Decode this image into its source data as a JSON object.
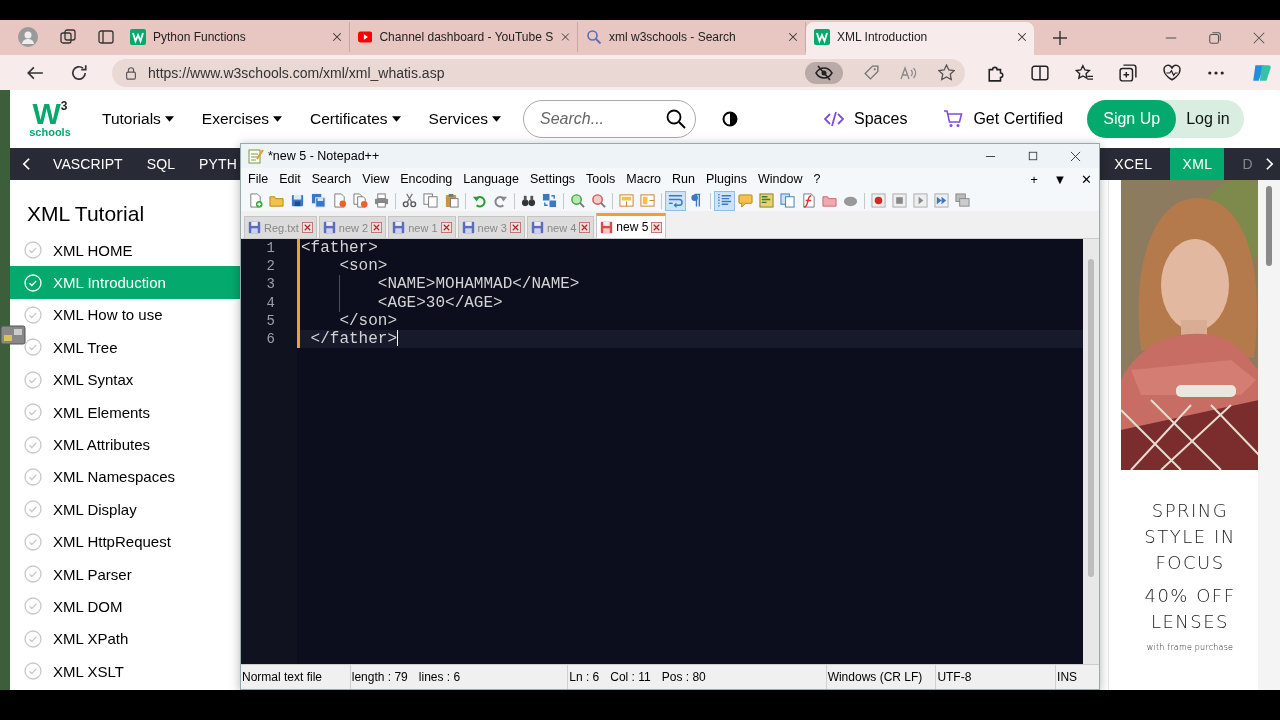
{
  "browser": {
    "tabs": [
      {
        "title": "Python Functions",
        "kind": "site",
        "selected": false
      },
      {
        "title": "Channel dashboard - YouTube S",
        "kind": "video",
        "selected": false
      },
      {
        "title": "xml w3schools - Search",
        "kind": "search",
        "selected": false
      },
      {
        "title": "XML Introduction",
        "kind": "site",
        "selected": true
      }
    ],
    "url": "https://www.w3schools.com/xml/xml_whatis.asp"
  },
  "site": {
    "logo": {
      "mark": "W",
      "sup": "3",
      "name": "schools"
    },
    "nav": [
      "Tutorials",
      "Exercises",
      "Certificates",
      "Services"
    ],
    "search": {
      "placeholder": "Search..."
    },
    "spaces": "Spaces",
    "certified": "Get Certified",
    "signup": "Sign Up",
    "login": "Log in",
    "topics_left": [
      {
        "label": "VASCRIPT",
        "selected": false
      },
      {
        "label": "SQL",
        "selected": false
      },
      {
        "label": "PYTH",
        "selected": false
      }
    ],
    "topics_right": [
      {
        "label": "XCEL",
        "selected": false
      },
      {
        "label": "XML",
        "selected": true
      },
      {
        "label": "D",
        "selected": false
      }
    ],
    "sidebar": {
      "title": "XML Tutorial",
      "items": [
        {
          "label": "XML HOME",
          "selected": false
        },
        {
          "label": "XML Introduction",
          "selected": true
        },
        {
          "label": "XML How to use",
          "selected": false
        },
        {
          "label": "XML Tree",
          "selected": false
        },
        {
          "label": "XML Syntax",
          "selected": false
        },
        {
          "label": "XML Elements",
          "selected": false
        },
        {
          "label": "XML Attributes",
          "selected": false
        },
        {
          "label": "XML Namespaces",
          "selected": false
        },
        {
          "label": "XML Display",
          "selected": false
        },
        {
          "label": "XML HttpRequest",
          "selected": false
        },
        {
          "label": "XML Parser",
          "selected": false
        },
        {
          "label": "XML DOM",
          "selected": false
        },
        {
          "label": "XML XPath",
          "selected": false
        },
        {
          "label": "XML XSLT",
          "selected": false
        }
      ]
    },
    "ad": {
      "headline": [
        "SPRING",
        "STYLE IN",
        "FOCUS"
      ],
      "offer": [
        "40% OFF",
        "LENSES"
      ],
      "note": "with frame purchase"
    }
  },
  "notepad": {
    "title": "*new 5 - Notepad++",
    "menu": [
      "File",
      "Edit",
      "Search",
      "View",
      "Encoding",
      "Language",
      "Settings",
      "Tools",
      "Macro",
      "Run",
      "Plugins",
      "Window",
      "?"
    ],
    "menu_right": [
      "+",
      "▼",
      "✕"
    ],
    "toolbar": [
      {
        "kind": "new",
        "pressed": false
      },
      {
        "kind": "open",
        "pressed": false
      },
      {
        "kind": "save",
        "pressed": false
      },
      {
        "kind": "saveall",
        "pressed": false
      },
      {
        "kind": "close",
        "pressed": false
      },
      {
        "kind": "closeall",
        "pressed": false
      },
      {
        "kind": "print",
        "pressed": false
      },
      {
        "kind": "separator"
      },
      {
        "kind": "cut",
        "pressed": false
      },
      {
        "kind": "copy",
        "pressed": false
      },
      {
        "kind": "paste",
        "pressed": false
      },
      {
        "kind": "separator"
      },
      {
        "kind": "undo",
        "pressed": false
      },
      {
        "kind": "redo",
        "pressed": false
      },
      {
        "kind": "separator"
      },
      {
        "kind": "find",
        "pressed": false
      },
      {
        "kind": "replace",
        "pressed": false
      },
      {
        "kind": "separator"
      },
      {
        "kind": "zoomin",
        "pressed": false
      },
      {
        "kind": "zoomout",
        "pressed": false
      },
      {
        "kind": "separator"
      },
      {
        "kind": "syncv",
        "pressed": false
      },
      {
        "kind": "synch",
        "pressed": false
      },
      {
        "kind": "separator"
      },
      {
        "kind": "wrap",
        "pressed": true
      },
      {
        "kind": "pilcrow",
        "pressed": false
      },
      {
        "kind": "separator"
      },
      {
        "kind": "indent",
        "pressed": true
      },
      {
        "kind": "udl",
        "pressed": false
      },
      {
        "kind": "map",
        "pressed": false
      },
      {
        "kind": "doclist",
        "pressed": false
      },
      {
        "kind": "funclist",
        "pressed": false
      },
      {
        "kind": "workspace",
        "pressed": false
      },
      {
        "kind": "monitor",
        "pressed": false
      },
      {
        "kind": "separator"
      },
      {
        "kind": "record",
        "pressed": false
      },
      {
        "kind": "stop",
        "pressed": false
      },
      {
        "kind": "play",
        "pressed": false
      },
      {
        "kind": "playmulti",
        "pressed": false
      },
      {
        "kind": "savemacro",
        "pressed": false
      }
    ],
    "tabs": [
      {
        "label": "Reg.txt",
        "selected": false,
        "modified": false
      },
      {
        "label": "new 2",
        "selected": false,
        "modified": false
      },
      {
        "label": "new 1",
        "selected": false,
        "modified": false
      },
      {
        "label": "new 3",
        "selected": false,
        "modified": false
      },
      {
        "label": "new 4",
        "selected": false,
        "modified": false
      },
      {
        "label": "new 5",
        "selected": true,
        "modified": true
      }
    ],
    "lines": [
      {
        "number": "1",
        "text": "<father>",
        "changed": true,
        "current": false
      },
      {
        "number": "2",
        "text": "    <son>",
        "changed": true,
        "current": false
      },
      {
        "number": "3",
        "text": "        <NAME>MOHAMMAD</NAME>",
        "changed": true,
        "current": false
      },
      {
        "number": "4",
        "text": "        <AGE>30</AGE>",
        "changed": true,
        "current": false
      },
      {
        "number": "5",
        "text": "    </son>",
        "changed": true,
        "current": false
      },
      {
        "number": "6",
        "text": " </father>",
        "changed": true,
        "current": true
      }
    ],
    "status": [
      [
        "Normal text file"
      ],
      [
        "length : 79",
        "lines : 6"
      ],
      [
        "Ln : 6",
        "Col : 11",
        "Pos : 80"
      ],
      [
        "Windows (CR LF)"
      ],
      [
        "UTF-8"
      ],
      [
        "INS"
      ]
    ]
  }
}
